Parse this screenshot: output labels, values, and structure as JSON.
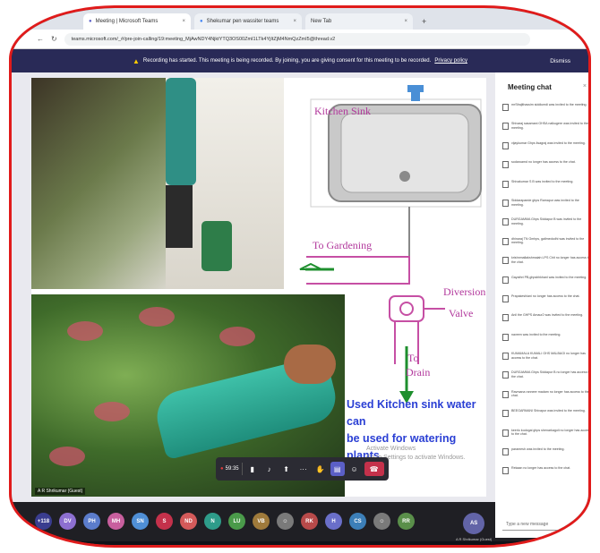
{
  "browser": {
    "tabs": [
      {
        "label": "Meeting | Microsoft Teams",
        "active": true
      },
      {
        "label": "Shekumar pen wassiter teams",
        "active": false
      },
      {
        "label": "New Tab",
        "active": false
      }
    ],
    "new_tab": "+",
    "url": "teams.microsoft.com/_#/pre-join-calling/19:meeting_MjAwNDY4NjktYTQ3OS00ZmI1LTk4YjItZjM4NmQzZmI5@thread.v2"
  },
  "banner": {
    "text": "Recording has started. This meeting is being recorded. By joining, you are giving consent for this meeting to be recorded.",
    "link": "Privacy policy",
    "dismiss": "Dismiss"
  },
  "slide": {
    "labels": {
      "kitchen_sink": "Kitchen Sink",
      "to_gardening": "To Gardening",
      "diversion": "Diversion",
      "valve": "Valve",
      "to": "To",
      "drain": "Drain"
    },
    "caption_line1": "Used Kitchen sink water can",
    "caption_line2": "be used for watering plants",
    "activate_line1": "Activate Windows",
    "activate_line2": "Go to Settings to activate Windows.",
    "presenter_name": "A R Shrikumar (Guest)"
  },
  "controls": {
    "record_time": "59:35",
    "icons": [
      "record-icon",
      "camera-icon",
      "mic-icon",
      "share-icon",
      "more-icon",
      "raise-hand-icon",
      "chat-icon",
      "participants-icon",
      "leave-icon"
    ],
    "colors": {
      "leave": "#c4314b",
      "selected": "#5b5fc7",
      "record": "#e03b3b"
    }
  },
  "chat": {
    "title": "Meeting chat",
    "close": "×",
    "input_placeholder": "Type a new message",
    "messages": [
      "mrSfrajithassim siddiumdi was invited to the meeting.",
      "Shivaraj sasamani GHSA nalkugere was invited to the meeting.",
      "vijaykumar Ghps ilsagraj was invited to the meeting.",
      "sodaroamd no longer has access to the chat.",
      "Shivakumar S B was invited to the meeting.",
      "Siddarapaede ghps Ramapur was invited to the meeting.",
      "DURGAMMA Ghps Siddapur B was invited to the meeting.",
      "dhinaraj TN Gmhps, gallmedodhi was invited to the meeting.",
      "krishnmallakshmaiah LPS Chit no longer has access to the chat.",
      "Gayathri PB,ghpsbhkhanl was invited to the meeting.",
      "Prapakeshiani no longer has access to the chat.",
      "Anil the GHPS Amaur2 was invited to the meeting.",
      "naveen was invited to the meeting.",
      "KUMAMALA KUMALI GHS MALBAGI no longer has access to the chat.",
      "DURGAMMA Ghps Siddapur B no longer has access to the chat.",
      "Ravrsana ranneer madam no longer has access to the chat.",
      "BEEGARMANI Shivapur was invited to the meeting.",
      "keerlo kodogal ghps shenarkagoli no longer has access to the chat.",
      "paramesh was invited to the meeting.",
      "Rekaan no longer has access to the chat."
    ]
  },
  "participants": [
    {
      "initials": "+118",
      "color": "#3a3d8f"
    },
    {
      "initials": "DV",
      "color": "#8d6fd1"
    },
    {
      "initials": "PH",
      "color": "#5b7ccc"
    },
    {
      "initials": "MH",
      "color": "#c85f9e"
    },
    {
      "initials": "SN",
      "color": "#4f8fd6"
    },
    {
      "initials": "S",
      "color": "#c4314b"
    },
    {
      "initials": "ND",
      "color": "#d45a5a"
    },
    {
      "initials": "N",
      "color": "#2e9c8a"
    },
    {
      "initials": "LU",
      "color": "#4a9a4a"
    },
    {
      "initials": "VB",
      "color": "#9f7a3b"
    },
    {
      "initials": "",
      "color": "#7a7a7a"
    },
    {
      "initials": "RK",
      "color": "#b84a4a"
    },
    {
      "initials": "H",
      "color": "#6a6fc9"
    },
    {
      "initials": "CS",
      "color": "#3c7fb8"
    },
    {
      "initials": "",
      "color": "#7a7a7a"
    },
    {
      "initials": "RR",
      "color": "#5a8f4a"
    }
  ],
  "self_view": {
    "initials": "AS",
    "name": "A R Shrikumar (Guest)"
  }
}
